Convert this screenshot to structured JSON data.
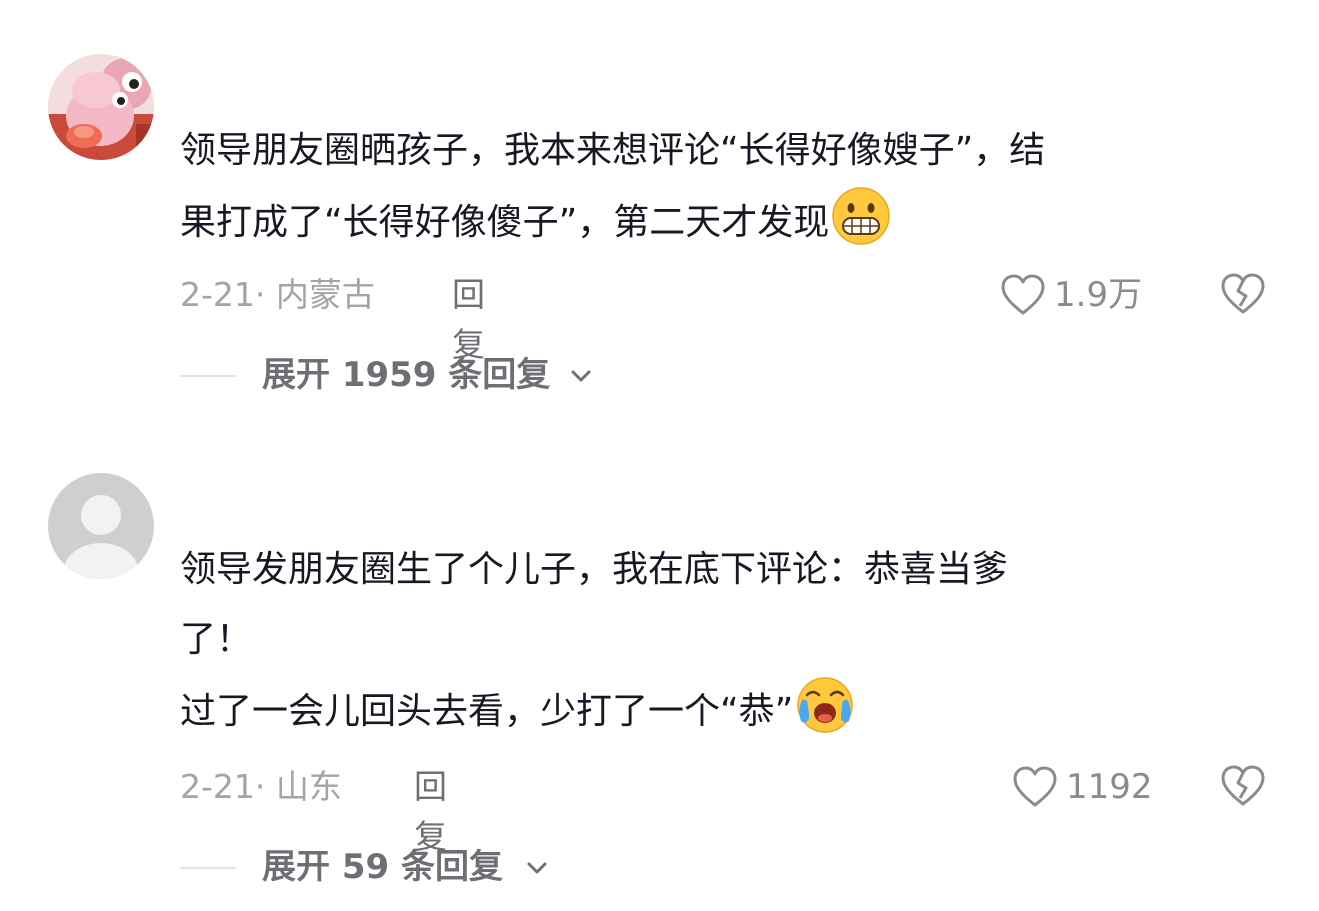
{
  "comments": [
    {
      "username": "",
      "body_lines": [
        "领导朋友圈晒孩子，我本来想评论“长得好像嫂子”，结",
        "果打成了“长得好像傻子”，第二天才发现"
      ],
      "emoji": "grin-emoji",
      "date": "2-21",
      "location": "· 内蒙古",
      "reply_label": "回复",
      "like_count": "1.9万",
      "expand_label": "展开 1959 条回复"
    },
    {
      "username": "",
      "body_lines": [
        "领导发朋友圈生了个儿子，我在底下评论：恭喜当爹",
        "了！",
        "过了一会儿回头去看，少打了一个“恭”"
      ],
      "emoji": "crying-emoji",
      "date": "2-21",
      "location": "· 山东",
      "reply_label": "回复",
      "like_count": "1192",
      "expand_label": "展开 59 条回复"
    }
  ],
  "icons": {
    "like": "heart-outline-icon",
    "dislike": "broken-heart-icon",
    "expand": "chevron-down-icon"
  },
  "colors": {
    "text": "#161823",
    "meta": "#a3a4a9",
    "reply": "#6e6f75",
    "rule": "#e3e3e6",
    "emoji_yellow": "#ffc83d"
  }
}
